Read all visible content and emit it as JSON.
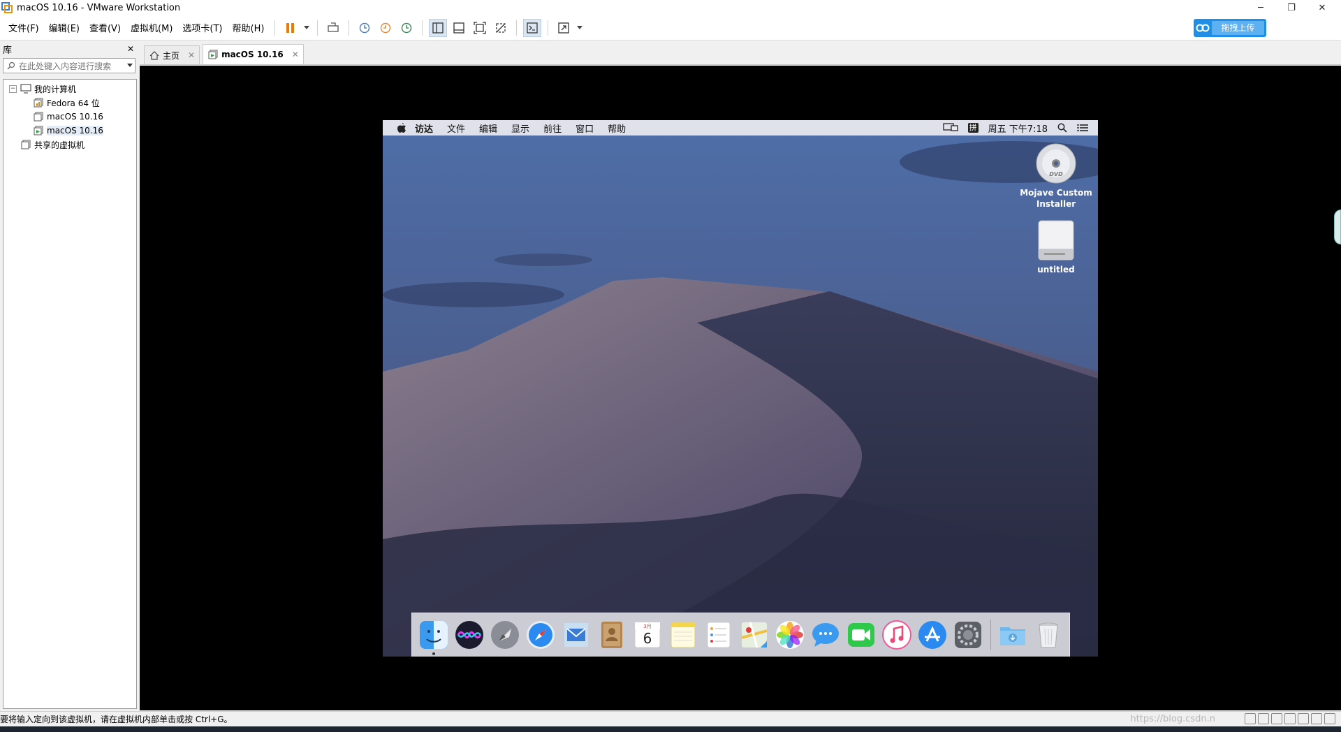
{
  "window": {
    "title": "macOS 10.16 - VMware Workstation",
    "min": "─",
    "restore": "❐",
    "close": "✕"
  },
  "menubar": {
    "items": [
      "文件(F)",
      "编辑(E)",
      "查看(V)",
      "虚拟机(M)",
      "选项卡(T)",
      "帮助(H)"
    ]
  },
  "upload": {
    "label": "拖拽上传"
  },
  "library": {
    "title": "库",
    "close": "✕",
    "search_placeholder": "在此处键入内容进行搜索",
    "tree": {
      "my_computer": "我的计算机",
      "vms": [
        "Fedora 64 位",
        "macOS 10.16",
        "macOS 10.16"
      ],
      "shared": "共享的虚拟机",
      "expander": "−"
    }
  },
  "tabs": [
    {
      "label": "主页",
      "close": "✕"
    },
    {
      "label": "macOS 10.16",
      "close": "✕"
    }
  ],
  "mac": {
    "menus": [
      "访达",
      "文件",
      "编辑",
      "显示",
      "前往",
      "窗口",
      "帮助"
    ],
    "ime": "拼",
    "clock": "周五 下午7:18",
    "desktop_icons": [
      {
        "label": "Mojave Custom Installer"
      },
      {
        "label": "untitled"
      }
    ],
    "dock": [
      "finder-icon",
      "siri-icon",
      "launchpad-icon",
      "safari-icon",
      "mail-icon",
      "contacts-icon",
      "calendar-icon",
      "notes-icon",
      "reminders-icon",
      "maps-icon",
      "photos-icon",
      "messages-icon",
      "facetime-icon",
      "itunes-icon",
      "app-store-icon",
      "system-preferences-icon",
      "downloads-icon",
      "trash-icon"
    ],
    "calendar_month": "3月",
    "calendar_day": "6"
  },
  "status": {
    "message": "要将输入定向到该虚拟机，请在虚拟机内部单击或按 Ctrl+G。",
    "watermark": "https://blog.csdn.n"
  }
}
